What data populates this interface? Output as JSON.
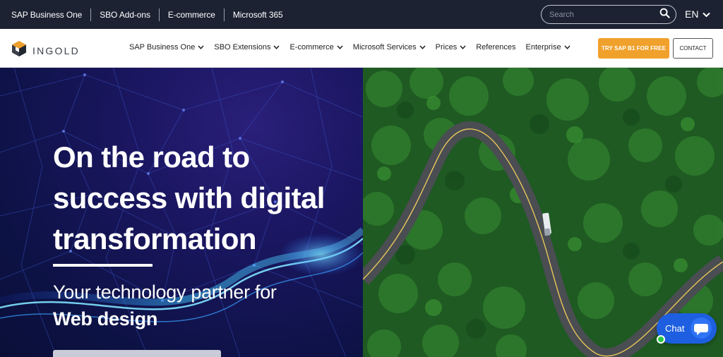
{
  "topbar": {
    "links": [
      "SAP Business One",
      "SBO Add-ons",
      "E-commerce",
      "Microsoft 365"
    ],
    "search_placeholder": "Search",
    "language": "EN"
  },
  "nav": {
    "logo_text": "INGOLD",
    "menu": [
      {
        "label": "SAP Business One",
        "dropdown": true
      },
      {
        "label": "SBO Extensions",
        "dropdown": true
      },
      {
        "label": "E-commerce",
        "dropdown": true
      },
      {
        "label": "Microsoft Services",
        "dropdown": true
      },
      {
        "label": "Prices",
        "dropdown": true
      },
      {
        "label": "References",
        "dropdown": false
      },
      {
        "label": "Enterprise",
        "dropdown": true
      }
    ],
    "try_button": "TRY SAP B1 FOR FREE",
    "contact_button": "CONTACT"
  },
  "hero": {
    "headline": "On the road to success with digital transformation",
    "subline": "Your technology partner for",
    "subline_strong": "Web design"
  },
  "chat": {
    "label": "Chat",
    "status": "online"
  },
  "colors": {
    "topbar": "#1c2232",
    "accent": "#f0a12c",
    "chat": "#1d5fe0",
    "hero_left": "#0d1245",
    "hero_right": "#1f5e24"
  }
}
